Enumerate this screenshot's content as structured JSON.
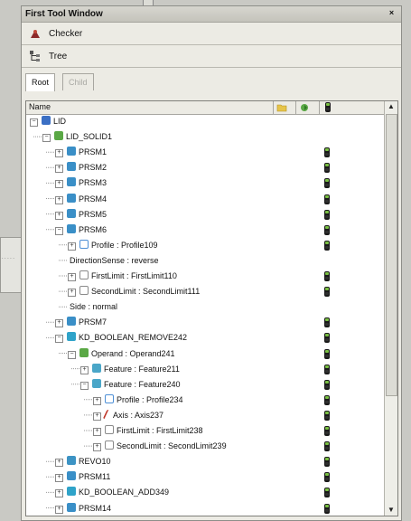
{
  "window": {
    "title": "First Tool Window",
    "close": "×"
  },
  "toolbar": {
    "checker_label": "Checker",
    "tree_label": "Tree"
  },
  "tabs": [
    {
      "label": "Root",
      "active": true
    },
    {
      "label": "Child",
      "active": false
    }
  ],
  "tree_header": {
    "name_label": "Name"
  },
  "tree_items": [
    {
      "label": "LID",
      "level": 0,
      "icon": "part-icon",
      "expanded": true,
      "status": false
    },
    {
      "label": "LID_SOLID1",
      "level": 1,
      "icon": "solid-icon",
      "expanded": true,
      "status": false
    },
    {
      "label": "PRSM1",
      "level": 2,
      "icon": "prism-icon",
      "expanded": false,
      "status": true
    },
    {
      "label": "PRSM2",
      "level": 2,
      "icon": "prism-icon",
      "expanded": false,
      "status": true
    },
    {
      "label": "PRSM3",
      "level": 2,
      "icon": "prism-icon",
      "expanded": false,
      "status": true
    },
    {
      "label": "PRSM4",
      "level": 2,
      "icon": "prism-icon",
      "expanded": false,
      "status": true
    },
    {
      "label": "PRSM5",
      "level": 2,
      "icon": "prism-icon",
      "expanded": false,
      "status": true
    },
    {
      "label": "PRSM6",
      "level": 2,
      "icon": "prism-icon",
      "expanded": true,
      "status": true
    },
    {
      "label": "Profile : Profile109",
      "level": 3,
      "icon": "profile-icon",
      "expanded": false,
      "status": true
    },
    {
      "label": "DirectionSense : reverse",
      "level": 3,
      "icon": "",
      "expanded": null,
      "status": false
    },
    {
      "label": "FirstLimit : FirstLimit110",
      "level": 3,
      "icon": "limit-icon",
      "expanded": false,
      "status": true
    },
    {
      "label": "SecondLimit : SecondLimit111",
      "level": 3,
      "icon": "limit-icon",
      "expanded": false,
      "status": true
    },
    {
      "label": "Side : normal",
      "level": 3,
      "icon": "",
      "expanded": null,
      "status": false
    },
    {
      "label": "PRSM7",
      "level": 2,
      "icon": "prism-icon",
      "expanded": false,
      "status": true
    },
    {
      "label": "KD_BOOLEAN_REMOVE242",
      "level": 2,
      "icon": "boolean-icon",
      "expanded": true,
      "status": true
    },
    {
      "label": "Operand : Operand241",
      "level": 3,
      "icon": "solid-icon",
      "expanded": true,
      "status": true
    },
    {
      "label": "Feature : Feature211",
      "level": 4,
      "icon": "feature-icon",
      "expanded": false,
      "status": true
    },
    {
      "label": "Feature : Feature240",
      "level": 4,
      "icon": "feature-icon",
      "expanded": true,
      "status": true
    },
    {
      "label": "Profile : Profile234",
      "level": 5,
      "icon": "profile-icon",
      "expanded": false,
      "status": true
    },
    {
      "label": "Axis : Axis237",
      "level": 5,
      "icon": "axis-icon",
      "expanded": false,
      "status": true
    },
    {
      "label": "FirstLimit : FirstLimit238",
      "level": 5,
      "icon": "limit-icon",
      "expanded": false,
      "status": true
    },
    {
      "label": "SecondLimit : SecondLimit239",
      "level": 5,
      "icon": "limit-icon",
      "expanded": false,
      "status": true
    },
    {
      "label": "REVO10",
      "level": 2,
      "icon": "revolve-icon",
      "expanded": false,
      "status": true
    },
    {
      "label": "PRSM11",
      "level": 2,
      "icon": "prism-icon",
      "expanded": false,
      "status": true
    },
    {
      "label": "KD_BOOLEAN_ADD349",
      "level": 2,
      "icon": "boolean-icon",
      "expanded": false,
      "status": true
    },
    {
      "label": "PRSM14",
      "level": 2,
      "icon": "prism-icon",
      "expanded": false,
      "status": true
    }
  ],
  "colors": {
    "prism": "#3a8fc7",
    "solid": "#5aa845",
    "status_green": "#7ac143"
  }
}
